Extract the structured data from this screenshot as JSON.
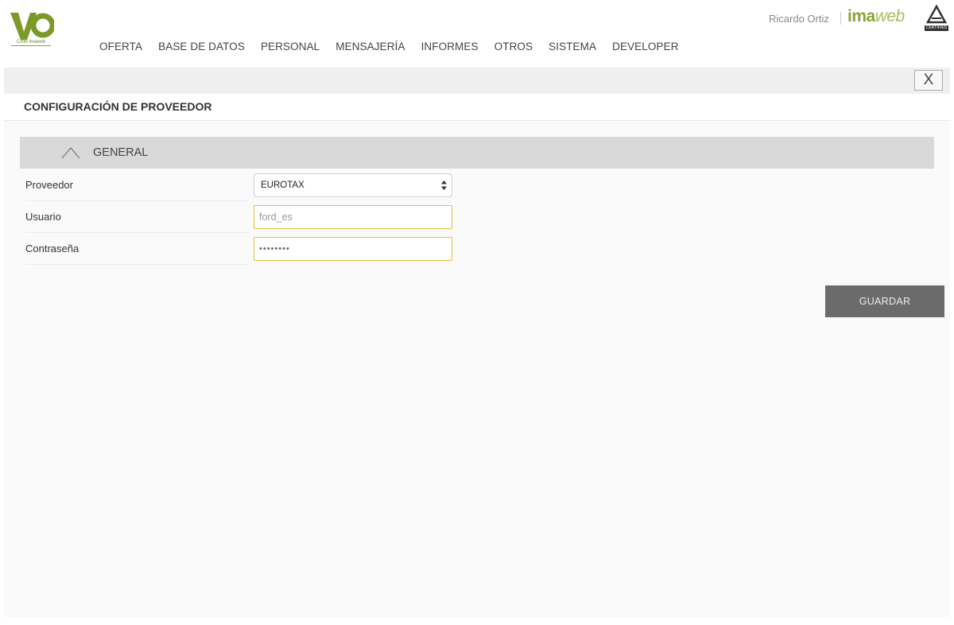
{
  "header": {
    "logo_sub": "CRM imaweb",
    "nav": [
      "OFERTA",
      "BASE DE DATOS",
      "PERSONAL",
      "MENSAJERÍA",
      "INFORMES",
      "OTROS",
      "SISTEMA",
      "DEVELOPER"
    ],
    "user_name": "Ricardo Ortiz",
    "brand_a": "ima",
    "brand_b": "web",
    "cert_label": "CERTIFIED"
  },
  "toolbar": {
    "close_label": "X"
  },
  "page": {
    "title": "CONFIGURACIÓN DE PROVEEDOR"
  },
  "section": {
    "title": "GENERAL",
    "fields": {
      "provider_label": "Proveedor",
      "provider_value": "EUROTAX",
      "user_label": "Usuario",
      "user_value": "ford_es",
      "password_label": "Contraseña",
      "password_value": "••••••••"
    }
  },
  "actions": {
    "save_label": "GUARDAR"
  },
  "colors": {
    "brand": "#8aa33a",
    "accent_border": "#e3c22a",
    "save_bg": "#6b6b6b"
  }
}
